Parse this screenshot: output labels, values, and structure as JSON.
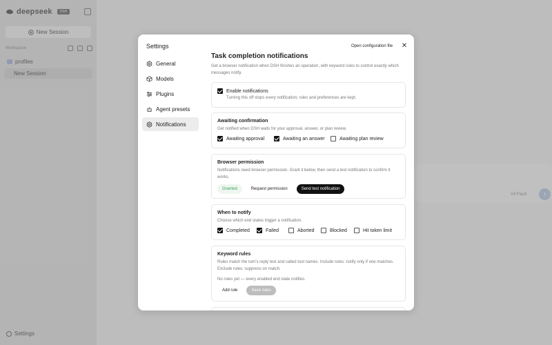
{
  "app": {
    "logo_text": "deepseek",
    "logo_badge": "DSH",
    "new_session_label": "New Session",
    "workspace_label": "Workspace",
    "folder_label": "profiles",
    "session_item_label": "New Session",
    "settings_label": "Settings",
    "model_label": "V4 Flash",
    "send_label": "↑"
  },
  "modal": {
    "title": "Settings",
    "open_config_label": "Open configuration file",
    "close_label": "✕",
    "nav": [
      {
        "label": "General",
        "icon": "gear-icon"
      },
      {
        "label": "Models",
        "icon": "cube-icon"
      },
      {
        "label": "Plugins",
        "icon": "plugins-icon"
      },
      {
        "label": "Agent presets",
        "icon": "agent-icon"
      },
      {
        "label": "Notifications",
        "icon": "bell-icon",
        "active": true
      }
    ],
    "section": {
      "title": "Task completion notifications",
      "description": "Get a browser notification when DSH finishes an operation, with keyword rules to control exactly which messages notify."
    },
    "enable": {
      "label": "Enable notifications",
      "description": "Turning this off stops every notification; rules and preferences are kept."
    },
    "awaiting": {
      "title": "Awaiting confirmation",
      "description": "Get notified when DSH waits for your approval, answer, or plan review.",
      "options": [
        {
          "label": "Awaiting approval",
          "checked": true
        },
        {
          "label": "Awaiting an answer",
          "checked": true
        },
        {
          "label": "Awaiting plan review",
          "checked": false
        }
      ]
    },
    "permission": {
      "title": "Browser permission",
      "description": "Notifications need browser permission. Grant it below, then send a test notification to confirm it works.",
      "status": "Granted",
      "request_label": "Request permission",
      "test_label": "Send test notification"
    },
    "when": {
      "title": "When to notify",
      "description": "Choose which end states trigger a notification.",
      "options": [
        {
          "label": "Completed",
          "checked": true
        },
        {
          "label": "Failed",
          "checked": true
        },
        {
          "label": "Aborted",
          "checked": false
        },
        {
          "label": "Blocked",
          "checked": false
        },
        {
          "label": "Hit token limit",
          "checked": false
        }
      ]
    },
    "keywords": {
      "title": "Keyword rules",
      "description": "Rules match the turn's reply text and called tool names. Include rules: notify only if one matches. Exclude rules: suppress on match.",
      "empty_text": "No rules yet — every enabled end state notifies.",
      "add_label": "Add rule",
      "save_label": "Save rules"
    }
  }
}
